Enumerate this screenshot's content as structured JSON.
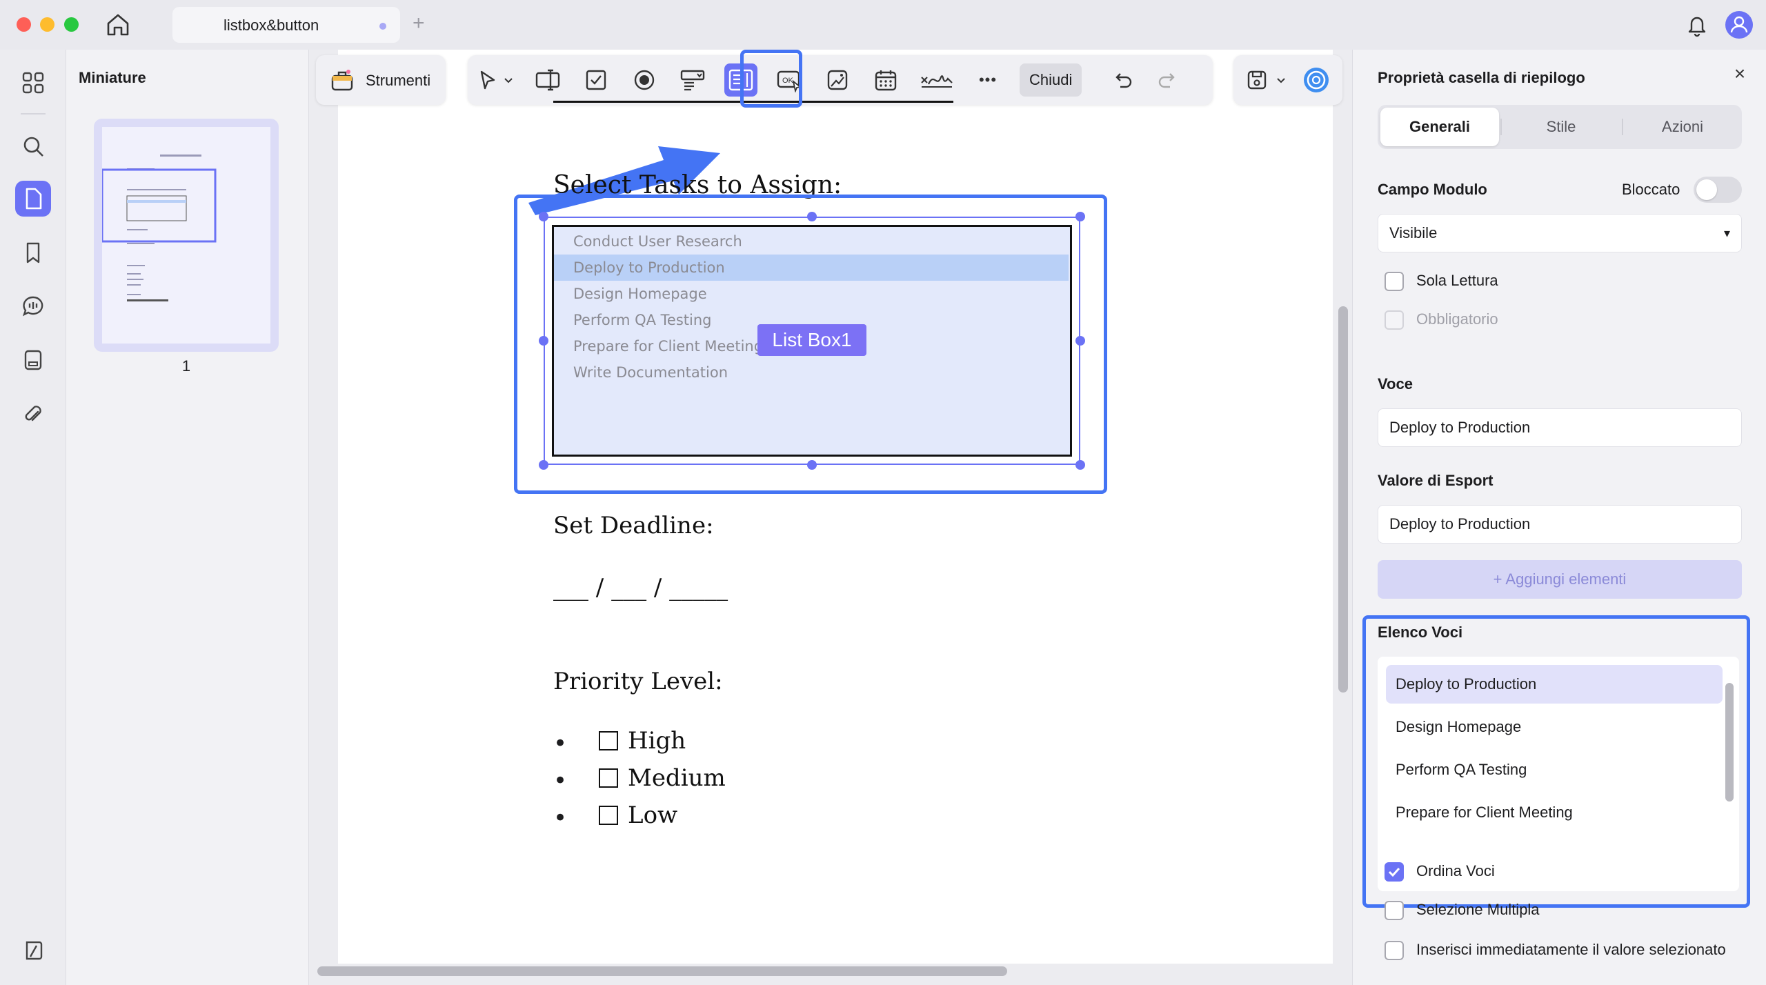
{
  "window": {
    "tab_title": "listbox&button",
    "new_tab": "+"
  },
  "thumbnails": {
    "title": "Miniature",
    "page_number": "1"
  },
  "toolbar": {
    "tools_label": "Strumenti",
    "close_label": "Chiudi",
    "more_glyph": "•••",
    "icons": [
      "pointer-icon",
      "text-field-icon",
      "checkbox-icon",
      "radio-button-icon",
      "combo-box-icon",
      "list-box-icon",
      "button-icon",
      "image-field-icon",
      "date-field-icon",
      "signature-icon",
      "more-icon",
      "undo-icon",
      "redo-icon",
      "save-icon",
      "ai-assistant-icon"
    ]
  },
  "document": {
    "heading_tasks": "Select Tasks to Assign:",
    "listbox_items": [
      "Conduct User Research",
      "Deploy to Production",
      "Design Homepage",
      "Perform QA Testing",
      "Prepare for Client Meeting",
      "Write Documentation"
    ],
    "listbox_selected_index": 1,
    "listbox_tag": "List Box1",
    "heading_deadline": "Set Deadline:",
    "deadline_blanks": "___ / ___ / _____",
    "heading_priority": "Priority Level:",
    "priority_options": [
      "High",
      "Medium",
      "Low"
    ]
  },
  "properties": {
    "title": "Proprietà casella di riepilogo",
    "close_glyph": "×",
    "tabs": [
      "Generali",
      "Stile",
      "Azioni"
    ],
    "active_tab": "Generali",
    "campo_modulo_label": "Campo Modulo",
    "bloccato_label": "Bloccato",
    "bloccato_on": false,
    "visibility_value": "Visibile",
    "sola_lettura_label": "Sola Lettura",
    "obbligatorio_label": "Obbligatorio",
    "voce_label": "Voce",
    "voce_value": "Deploy to Production",
    "valore_label": "Valore di Esport",
    "valore_value": "Deploy to Production",
    "add_button": "+ Aggiungi elementi",
    "elenco_label": "Elenco Voci",
    "elenco_items": [
      "Deploy to Production",
      "Design Homepage",
      "Perform QA Testing",
      "Prepare for Client Meeting"
    ],
    "ordina_label": "Ordina Voci",
    "ordina_checked": true,
    "selezione_label": "Selezione Multipla",
    "inserisci_label": "Inserisci immediatamente il valore selezionato"
  },
  "colors": {
    "accent": "#6b72f5",
    "highlight": "#4474f4",
    "listbox_bg": "#e3e9fb"
  }
}
